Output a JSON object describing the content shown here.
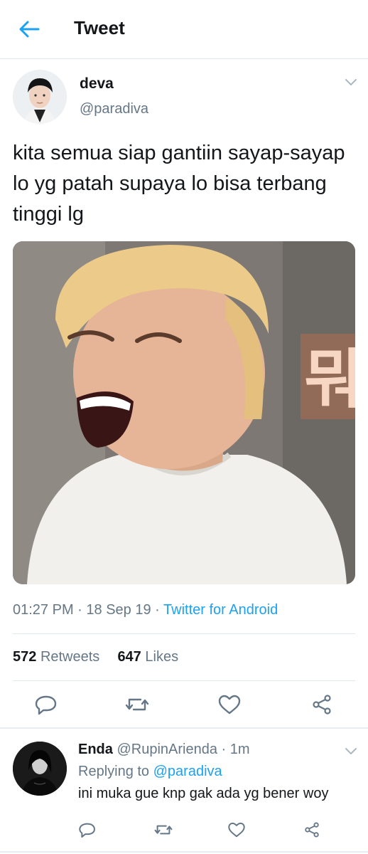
{
  "header": {
    "title": "Tweet",
    "back_icon": "back-arrow-icon"
  },
  "tweet": {
    "author_name": "deva",
    "author_handle": "@paradiva",
    "text": "kita semua siap gantiin sayap-sayap lo yg patah supaya lo bisa terbang tinggi lg",
    "time": "01:27 PM",
    "date": "18 Sep 19",
    "source": "Twitter for Android",
    "retweets_count": "572",
    "retweets_label": "Retweets",
    "likes_count": "647",
    "likes_label": "Likes",
    "media_text": "뭐"
  },
  "reply": {
    "name": "Enda",
    "handle": "@RupinArienda",
    "time": "1m",
    "replying_label": "Replying to",
    "replying_handle": "@paradiva",
    "text": "ini muka gue knp gak ada yg bener woy"
  },
  "colors": {
    "accent": "#1da1f2",
    "secondary_text": "#657786",
    "primary_text": "#14171a",
    "divider": "#e1e8ed"
  }
}
